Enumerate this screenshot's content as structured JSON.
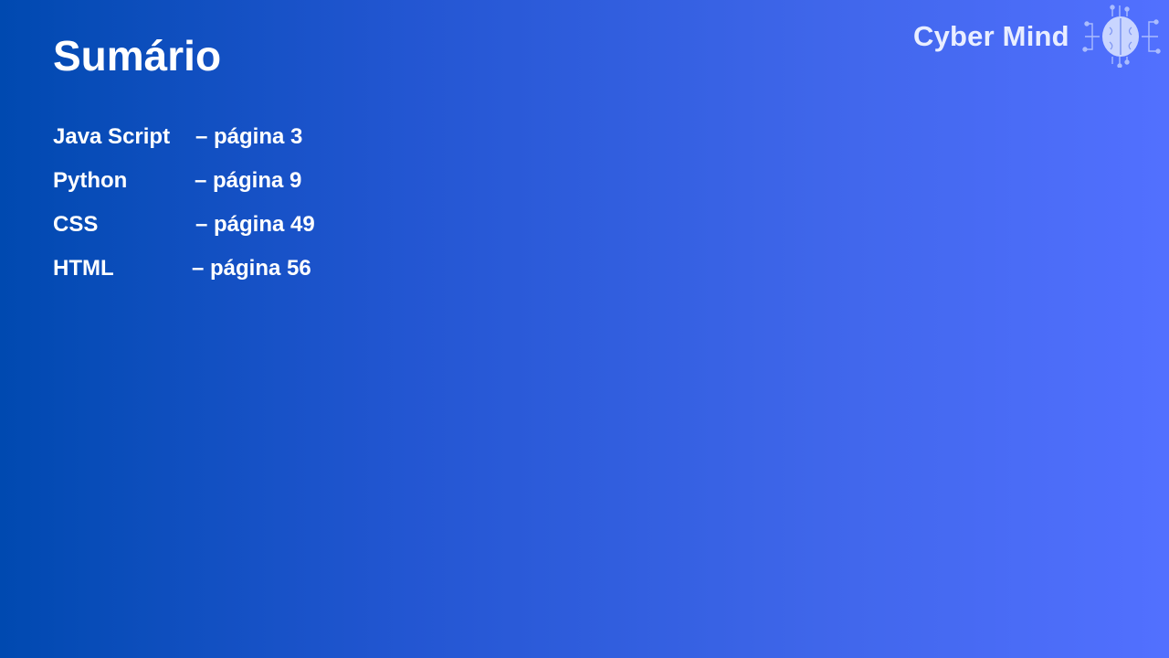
{
  "slide": {
    "title": "Sumário",
    "toc": [
      {
        "name": "Java Script",
        "page": "– página 3"
      },
      {
        "name": "Python",
        "page": "– página 9"
      },
      {
        "name": "CSS",
        "page": "– página 49"
      },
      {
        "name": "HTML",
        "page": "– página 56"
      }
    ]
  },
  "logo": {
    "text": "Cyber Mind",
    "icon": "brain-circuit-icon"
  },
  "colors": {
    "background_left": "#0049b0",
    "background_right": "#5270ff",
    "text": "#ffffff",
    "logo_text": "#e9eeff",
    "logo_icon": "#c9d6ff"
  }
}
